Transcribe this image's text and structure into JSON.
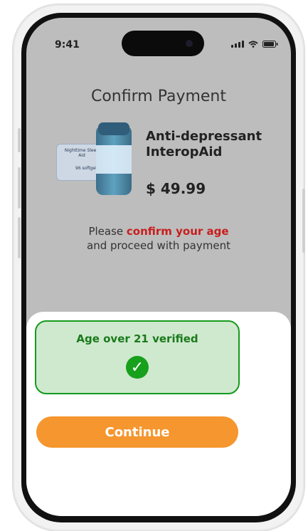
{
  "status": {
    "time": "9:41"
  },
  "page": {
    "title": "Confirm Payment",
    "product": {
      "name": "Anti-depressant\nInteropAid",
      "price": "$ 49.99",
      "box_label": "Nighttime\nSleep Aid",
      "box_count": "96\nsoftgels"
    },
    "notice": {
      "prefix": "Please ",
      "highlight": "confirm your age",
      "suffix": "and proceed with payment"
    }
  },
  "sheet": {
    "verified_text": "Age over 21 verified",
    "check_symbol": "✓",
    "continue_label": "Continue"
  },
  "colors": {
    "accent_orange": "#f5962e",
    "success_green": "#17a01c",
    "warning_red": "#c81e1e"
  }
}
